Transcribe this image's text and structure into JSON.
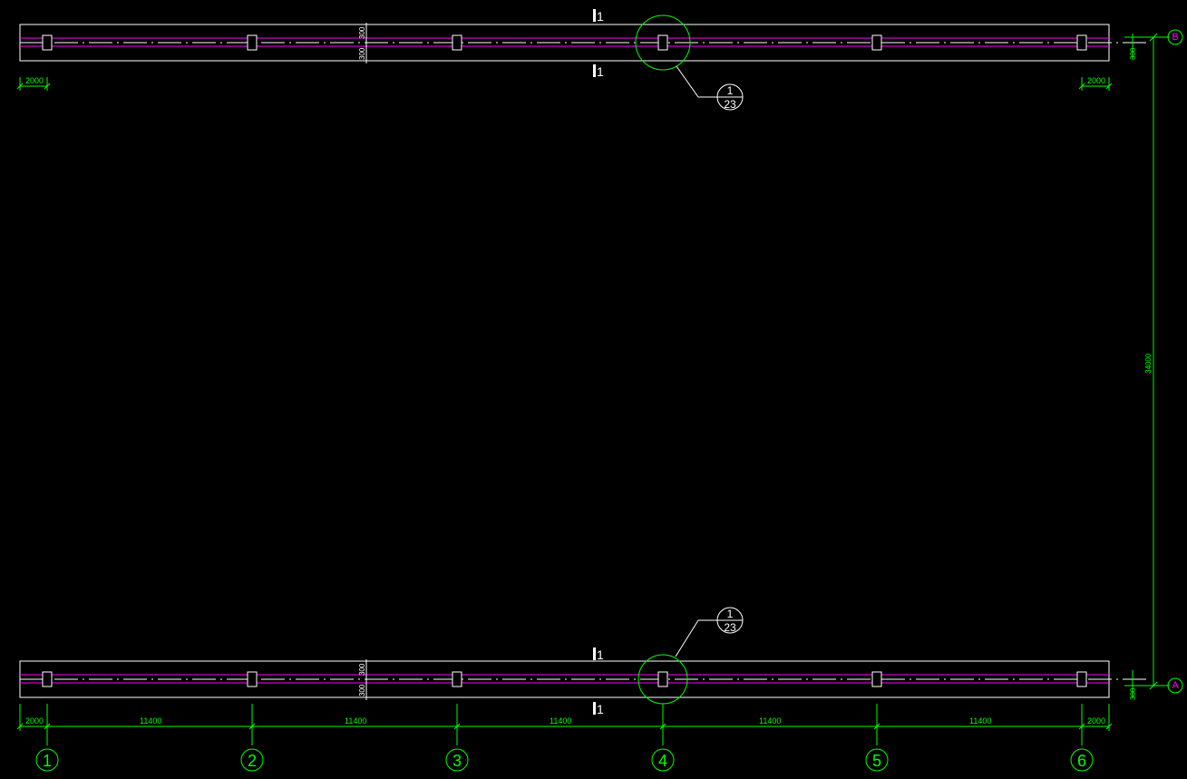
{
  "colors": {
    "background": "#000000",
    "outline": "#ffffff",
    "centerline": "#ff00ff",
    "dimension": "#00ff00"
  },
  "axes_numbered": [
    "1",
    "2",
    "3",
    "4",
    "5",
    "6"
  ],
  "axes_lettered": [
    "A",
    "B"
  ],
  "spans": {
    "edge": "2000",
    "bay": "11400",
    "between_rows": "34000",
    "offset": "300"
  },
  "beam_section": {
    "half_width_top": "300",
    "half_width_bottom": "300"
  },
  "section_mark": "1",
  "detail_callout": {
    "number": "1",
    "sheet": "23"
  }
}
